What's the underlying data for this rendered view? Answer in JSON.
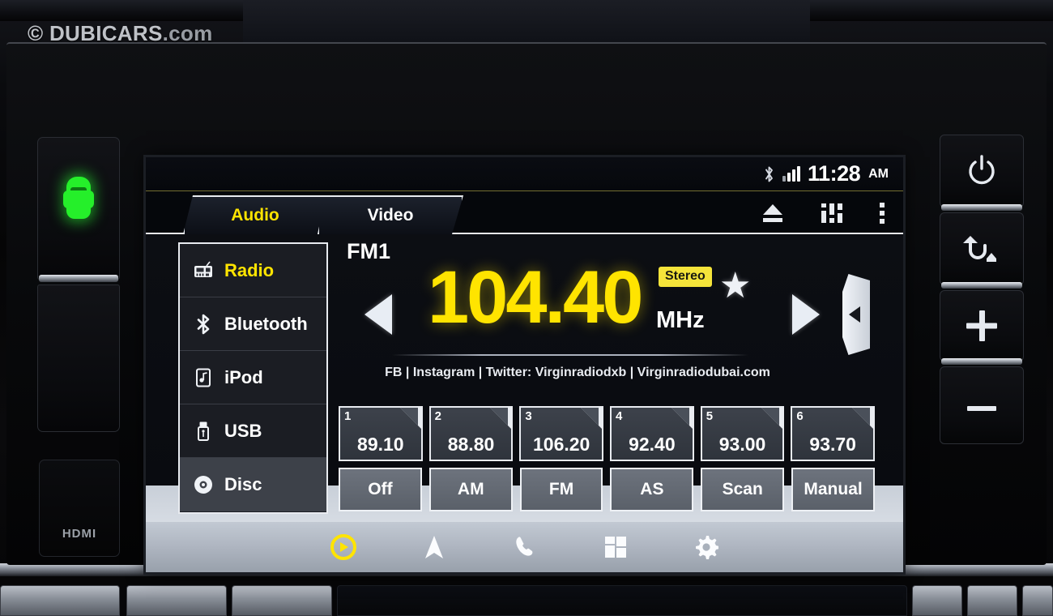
{
  "watermark": {
    "text": "© DUBICARS",
    "domain": ".com"
  },
  "status_bar": {
    "bluetooth_icon": "bluetooth-icon",
    "signal_icon": "signal-bars-icon",
    "time": "11:28",
    "meridiem": "AM"
  },
  "tabs": [
    {
      "label": "Audio",
      "active": true
    },
    {
      "label": "Video",
      "active": false
    }
  ],
  "tab_actions": [
    {
      "name": "eject-icon",
      "label": "Eject"
    },
    {
      "name": "equalizer-icon",
      "label": "Equalizer"
    },
    {
      "name": "more-options-icon",
      "label": "More"
    }
  ],
  "sidebar": {
    "items": [
      {
        "label": "Radio",
        "icon": "radio-icon",
        "state": "active"
      },
      {
        "label": "Bluetooth",
        "icon": "bluetooth-icon",
        "state": "normal"
      },
      {
        "label": "iPod",
        "icon": "ipod-icon",
        "state": "normal"
      },
      {
        "label": "USB",
        "icon": "usb-icon",
        "state": "normal"
      },
      {
        "label": "Disc",
        "icon": "disc-icon",
        "state": "dim"
      }
    ]
  },
  "tuner": {
    "band": "FM1",
    "frequency": "104.40",
    "unit": "MHz",
    "stereo_badge": "Stereo",
    "favorite_icon": "star-icon",
    "prev_label": "Tune Down",
    "next_label": "Tune Up",
    "rds_text": "FB | Instagram | Twitter: Virginradiodxb | Virginradiodubai.com",
    "panel_handle_icon": "collapse-panel-icon"
  },
  "presets": [
    {
      "number": "1",
      "frequency": "89.10"
    },
    {
      "number": "2",
      "frequency": "88.80"
    },
    {
      "number": "3",
      "frequency": "106.20"
    },
    {
      "number": "4",
      "frequency": "92.40"
    },
    {
      "number": "5",
      "frequency": "93.00"
    },
    {
      "number": "6",
      "frequency": "93.70"
    }
  ],
  "controls": [
    {
      "label": "Off"
    },
    {
      "label": "AM"
    },
    {
      "label": "FM"
    },
    {
      "label": "AS"
    },
    {
      "label": "Scan"
    },
    {
      "label": "Manual"
    }
  ],
  "bottom_nav": [
    {
      "name": "media-icon",
      "label": "Media",
      "active": true
    },
    {
      "name": "navigation-icon",
      "label": "Navigation",
      "active": false
    },
    {
      "name": "phone-icon",
      "label": "Phone",
      "active": false
    },
    {
      "name": "apps-icon",
      "label": "Apps",
      "active": false
    },
    {
      "name": "settings-icon",
      "label": "Settings",
      "active": false
    }
  ],
  "hardware": {
    "left_buttons": [
      {
        "name": "vehicle-info-button",
        "icon": "green-car-icon"
      },
      {
        "name": "blank-button",
        "icon": "none"
      }
    ],
    "hdmi_label": "HDMI",
    "right_buttons": [
      {
        "name": "power-button",
        "icon": "power-icon",
        "glyph": "⏻"
      },
      {
        "name": "back-home-button",
        "icon": "back-home-icon",
        "glyph": "↰"
      },
      {
        "name": "volume-up-button",
        "icon": "plus-icon",
        "glyph": "+"
      },
      {
        "name": "volume-down-button",
        "icon": "minus-icon",
        "glyph": "–"
      }
    ]
  },
  "colors": {
    "accent_yellow": "#ffe400",
    "stereo_badge": "#f5e43a",
    "screen_bg": "#0a0b0f",
    "panel_border": "#e8ebf0",
    "car_green": "#25ef2a"
  }
}
